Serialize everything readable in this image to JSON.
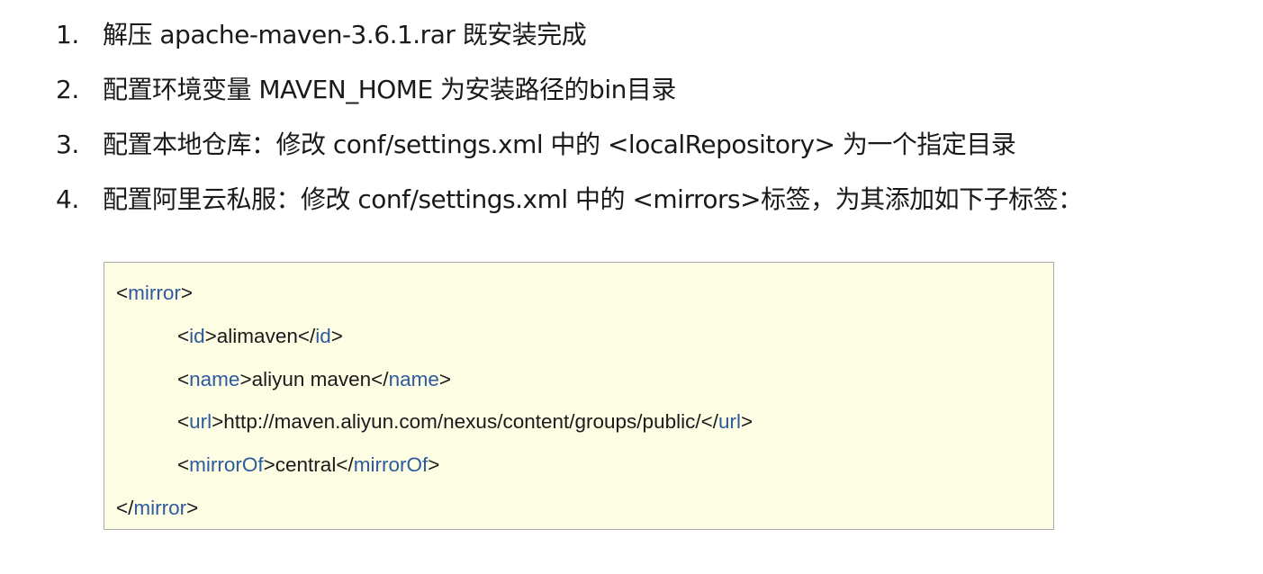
{
  "steps": [
    {
      "num": "1.",
      "text": "解压 apache-maven-3.6.1.rar 既安装完成"
    },
    {
      "num": "2.",
      "text": "配置环境变量 MAVEN_HOME 为安装路径的bin目录"
    },
    {
      "num": "3.",
      "text": "配置本地仓库：修改 conf/settings.xml 中的 <localRepository> 为一个指定目录"
    },
    {
      "num": "4.",
      "text": "配置阿里云私服：修改 conf/settings.xml 中的 <mirrors>标签，为其添加如下子标签："
    }
  ],
  "code": {
    "mirror_tag": "mirror",
    "id_tag": "id",
    "id_value": "alimaven",
    "name_tag": "name",
    "name_value": "aliyun maven",
    "url_tag": "url",
    "url_value": "http://maven.aliyun.com/nexus/content/groups/public/",
    "mirrorof_tag": "mirrorOf",
    "mirrorof_value": "central"
  },
  "colors": {
    "code_background": "#fdfde4",
    "tag_name": "#2e5a9e",
    "text": "#1a1a1a"
  }
}
